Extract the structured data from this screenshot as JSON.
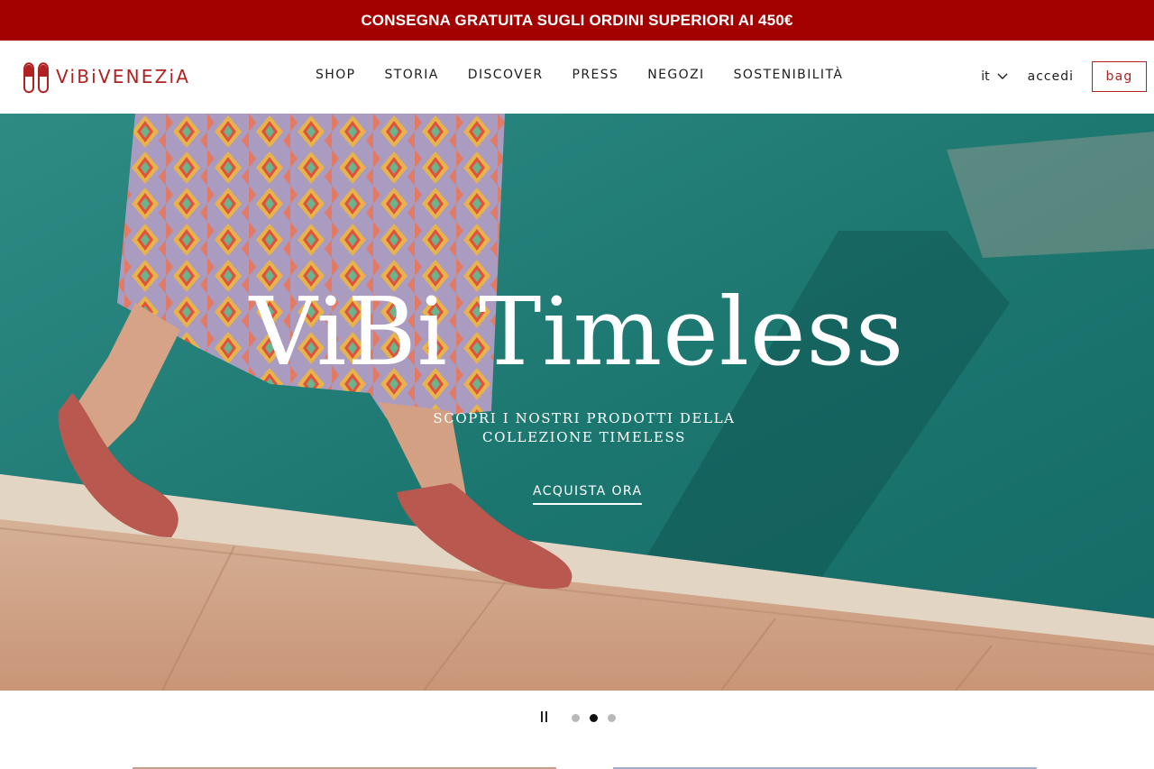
{
  "promo": {
    "text": "CONSEGNA GRATUITA SUGLI ORDINI SUPERIORI AI 450€"
  },
  "brand": {
    "name": "ViBiVENEZiA",
    "color": "#b22121",
    "promo_color": "#a30000"
  },
  "nav": {
    "items": [
      {
        "label": "SHOP"
      },
      {
        "label": "STORIA"
      },
      {
        "label": "DISCOVER"
      },
      {
        "label": "PRESS"
      },
      {
        "label": "NEGOZI"
      },
      {
        "label": "SOSTENIBILITÀ"
      }
    ]
  },
  "header_right": {
    "language": "it",
    "login": "accedi",
    "bag": "bag"
  },
  "hero": {
    "title": "ViBi Timeless",
    "subtitle": "SCOPRI I NOSTRI PRODOTTI DELLA COLLEZIONE TIMELESS",
    "cta": "ACQUISTA ORA"
  },
  "carousel": {
    "slides": 3,
    "active_index": 1,
    "pause_icon": "pause-icon"
  }
}
